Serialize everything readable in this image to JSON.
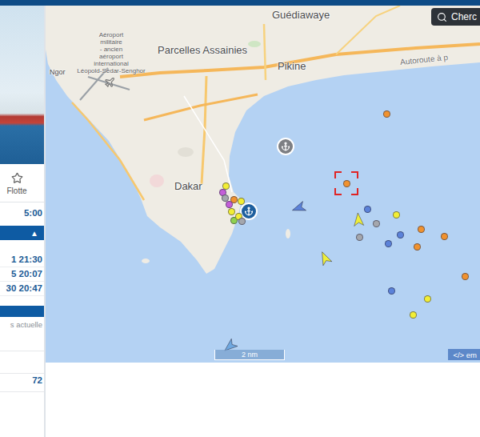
{
  "sidebar": {
    "fleet": {
      "label": "Flotte"
    },
    "time": "5:00",
    "toggle": "▲",
    "events": [
      "1 21:30",
      "5 20:07",
      "30 20:47"
    ],
    "status_label": "s actuelle",
    "value": "72"
  },
  "map": {
    "search": {
      "placeholder": "Cherc"
    },
    "labels": [
      {
        "text": "Guédiawaye",
        "kind": "city"
      },
      {
        "text": "Parcelles Assainies",
        "kind": "city"
      },
      {
        "text": "Pikine",
        "kind": "city"
      },
      {
        "text": "Dakar",
        "kind": "city"
      },
      {
        "text": "Ngor",
        "kind": "small"
      },
      {
        "text": "Autoroute à p",
        "kind": "road"
      }
    ],
    "airport": [
      "Aéroport",
      "militaire",
      "- ancien",
      "aéroport",
      "international",
      "Léopold-Sédar-Senghor"
    ],
    "scale": "2 nm",
    "embed": "</> em",
    "anchors": [
      {
        "color": "#7d7f83"
      },
      {
        "color": "#1e5f9e"
      }
    ],
    "vessels": [
      {
        "kind": "circle",
        "color": "#f0922f",
        "selected": false
      },
      {
        "kind": "circle",
        "color": "#f0922f",
        "selected": true
      },
      {
        "kind": "circle",
        "color": "#5b82d9",
        "selected": false
      },
      {
        "kind": "circle",
        "color": "#a4a7ad",
        "selected": false
      },
      {
        "kind": "circle",
        "color": "#f2ee35",
        "selected": false
      },
      {
        "kind": "circle",
        "color": "#a4a7ad",
        "selected": false
      },
      {
        "kind": "circle",
        "color": "#5b82d9",
        "selected": false
      },
      {
        "kind": "circle",
        "color": "#5b82d9",
        "selected": false
      },
      {
        "kind": "circle",
        "color": "#f0922f",
        "selected": false
      },
      {
        "kind": "circle",
        "color": "#f0922f",
        "selected": false
      },
      {
        "kind": "circle",
        "color": "#f0922f",
        "selected": false
      },
      {
        "kind": "circle",
        "color": "#f0922f",
        "selected": false
      },
      {
        "kind": "circle",
        "color": "#5b82d9",
        "selected": false
      },
      {
        "kind": "circle",
        "color": "#f2ee35",
        "selected": false
      },
      {
        "kind": "circle",
        "color": "#f2ee35",
        "selected": false
      },
      {
        "kind": "arrow",
        "color": "#eeee3a",
        "selected": false
      },
      {
        "kind": "arrow",
        "color": "#eeee3a",
        "selected": false
      },
      {
        "kind": "arrow",
        "color": "#5b82d9",
        "selected": false
      },
      {
        "kind": "arrow",
        "color": "#6fa8e0",
        "selected": false
      },
      {
        "kind": "circle",
        "color": "#f2ee35",
        "selected": false
      },
      {
        "kind": "circle",
        "color": "#c35ed8",
        "selected": false
      },
      {
        "kind": "circle",
        "color": "#a4a7ad",
        "selected": false
      },
      {
        "kind": "circle",
        "color": "#f0922f",
        "selected": false
      },
      {
        "kind": "circle",
        "color": "#f2ee35",
        "selected": false
      },
      {
        "kind": "circle",
        "color": "#c35ed8",
        "selected": false
      },
      {
        "kind": "circle",
        "color": "#f2ee35",
        "selected": false
      },
      {
        "kind": "circle",
        "color": "#8fd14f",
        "selected": false
      },
      {
        "kind": "circle",
        "color": "#f2ee35",
        "selected": false
      },
      {
        "kind": "circle",
        "color": "#a4a7ad",
        "selected": false
      }
    ]
  }
}
